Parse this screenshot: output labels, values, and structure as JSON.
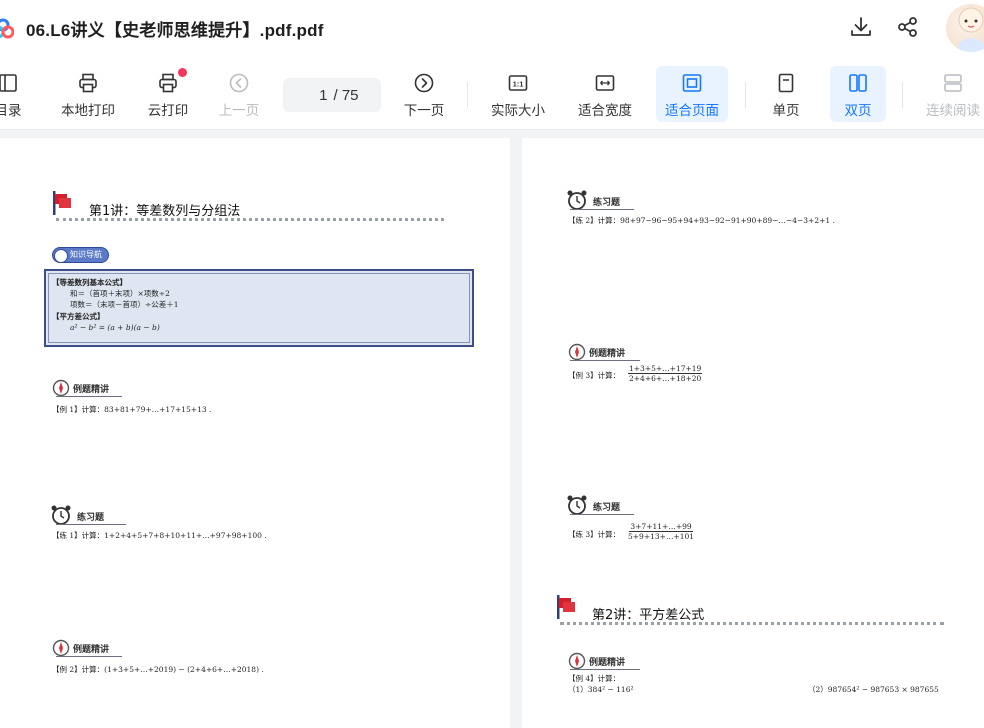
{
  "window": {
    "title": "06.L6讲义【史老师思维提升】.pdf.pdf"
  },
  "toolbar": {
    "items": [
      {
        "label": "目录",
        "icon": "toc-icon"
      },
      {
        "label": "本地打印",
        "icon": "printer-icon"
      },
      {
        "label": "云打印",
        "icon": "cloud-printer-icon"
      },
      {
        "label": "上一页",
        "icon": "chevron-left-circle-icon"
      },
      {
        "label": "下一页",
        "icon": "chevron-right-circle-icon"
      },
      {
        "label": "实际大小",
        "icon": "actual-size-icon"
      },
      {
        "label": "适合宽度",
        "icon": "fit-width-icon"
      },
      {
        "label": "适合页面",
        "icon": "fit-page-icon"
      },
      {
        "label": "单页",
        "icon": "single-page-icon"
      },
      {
        "label": "双页",
        "icon": "double-page-icon"
      },
      {
        "label": "连续阅读",
        "icon": "continuous-icon"
      }
    ],
    "page_current": "1",
    "page_total": "/ 75",
    "zoom_badge": "1:1"
  },
  "colors": {
    "accent": "#1677ff",
    "active_bg": "#e9f3ff",
    "disabled": "#b9bcc2",
    "badge": "#5b7bc9",
    "notify_dot": "#f5365c"
  },
  "left_page": {
    "lecture1_title": "第1讲：等差数列与分组法",
    "nav_badge": "知识导航",
    "formula_heading1": "【等差数列基本公式】",
    "formula_line1": "和＝（首项＋末项）×项数÷2",
    "formula_line2": "项数＝（末项－首项）÷公差＋1",
    "formula_heading2": "【平方差公式】",
    "formula_line3": "a² − b² = (a + b)(a − b)",
    "example_title_1": "例题精讲",
    "example_1": "【例 1】计算：83+81+79+…+17+15+13 .",
    "practice_title_1": "练习题",
    "practice_1": "【练 1】计算：1+2+4+5+7+8+10+11+…+97+98+100 .",
    "example_title_2": "例题精讲",
    "example_2": "【例 2】计算：(1+3+5+…+2019) − (2+4+6+…+2018) ."
  },
  "right_page": {
    "practice_title_2": "练习题",
    "practice_2": "【练 2】计算：98+97−96−95+94+93−92−91+90+89−…−4−3+2+1 .",
    "example_title_3": "例题精讲",
    "example_3_label": "【例 3】计算：",
    "example_3_num": "1+3+5+…+17+19",
    "example_3_den": "2+4+6+…+18+20",
    "practice_title_3": "练习题",
    "practice_3_label": "【练 3】计算：",
    "practice_3_num": "3+7+11+…+99",
    "practice_3_den": "5+9+13+…+101",
    "lecture2_title": "第2讲：平方差公式",
    "example_title_4": "例题精讲",
    "example_4_label": "【例 4】计算：",
    "example_4_part1": "（1）384² − 116²",
    "example_4_part2": "（2）987654² − 987653 × 987655"
  }
}
